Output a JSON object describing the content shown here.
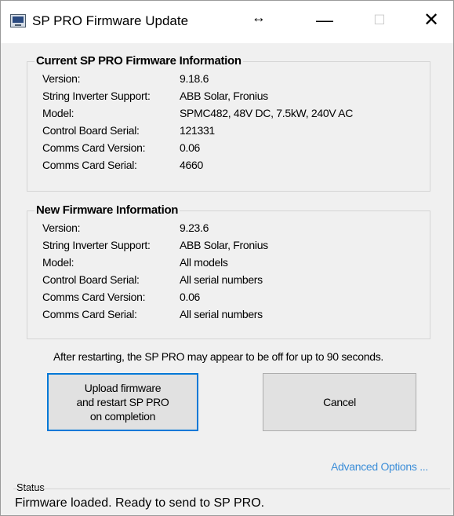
{
  "window": {
    "title": "SP PRO Firmware Update",
    "resize_cursor": "↔",
    "minimize_glyph": "—",
    "maximize_glyph": "☐",
    "close_glyph": "✕"
  },
  "current_firmware": {
    "heading": "Current SP PRO Firmware Information",
    "rows": [
      {
        "label": "Version:",
        "value": "9.18.6"
      },
      {
        "label": "String Inverter Support:",
        "value": "ABB Solar, Fronius"
      },
      {
        "label": "Model:",
        "value": "SPMC482, 48V DC, 7.5kW, 240V AC"
      },
      {
        "label": "Control Board Serial:",
        "value": "121331"
      },
      {
        "label": "Comms Card Version:",
        "value": "0.06"
      },
      {
        "label": "Comms Card Serial:",
        "value": "4660"
      }
    ]
  },
  "new_firmware": {
    "heading": "New Firmware Information",
    "rows": [
      {
        "label": "Version:",
        "value": "9.23.6"
      },
      {
        "label": "String Inverter Support:",
        "value": "ABB Solar, Fronius"
      },
      {
        "label": "Model:",
        "value": "All models"
      },
      {
        "label": "Control Board Serial:",
        "value": "All serial numbers"
      },
      {
        "label": "Comms Card Version:",
        "value": "0.06"
      },
      {
        "label": "Comms Card Serial:",
        "value": "All serial numbers"
      }
    ]
  },
  "restart_note": "After restarting, the SP PRO may appear to be off for up to 90 seconds.",
  "buttons": {
    "upload_label": "Upload firmware\nand restart SP PRO\non completion",
    "cancel_label": "Cancel"
  },
  "advanced_options_link": "Advanced Options ...",
  "status": {
    "label": "Status",
    "text": "Firmware loaded. Ready to send to SP PRO."
  },
  "colors": {
    "focus_border": "#0078d7",
    "link": "#3c8ed8",
    "window_bg": "#f0f0f0"
  }
}
